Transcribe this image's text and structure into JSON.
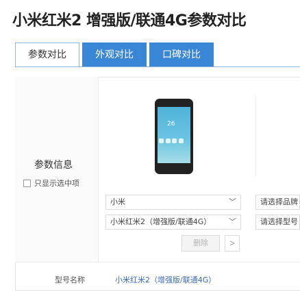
{
  "title": "小米红米2 增强版/联通4G参数对比",
  "tabs": [
    {
      "label": "参数对比",
      "active": true
    },
    {
      "label": "外观对比",
      "active": false
    },
    {
      "label": "口碑对比",
      "active": false
    }
  ],
  "sidebar": {
    "param_title": "参数信息",
    "only_show_label": "只显示选中项",
    "only_show_checked": false
  },
  "phone_screen": {
    "clock": "26"
  },
  "product1": {
    "brand_select": "小米",
    "model_select": "小米红米2（增强版/联通4G）",
    "delete_label": "删除",
    "next_label": ">"
  },
  "product2": {
    "brand_placeholder": "请选择品牌",
    "model_placeholder": "请选择型号"
  },
  "spec_rows": [
    {
      "label": "型号名称",
      "value": "小米红米2（增强版/联通4G）"
    }
  ],
  "colors": {
    "accent": "#3a86d6",
    "link": "#3a6cb8"
  }
}
